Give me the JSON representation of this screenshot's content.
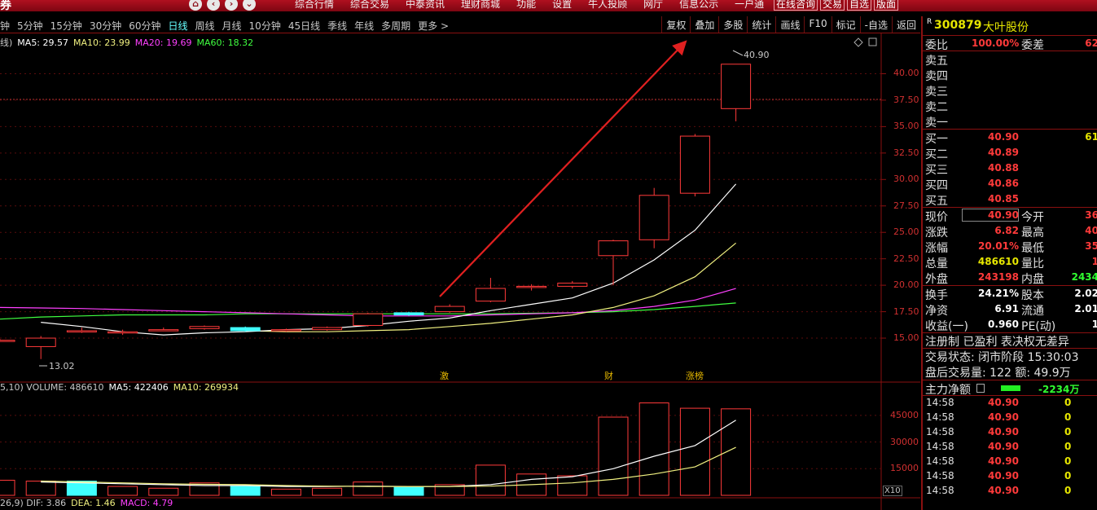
{
  "topbar": {
    "brand": "券",
    "menu": [
      "综合行情",
      "综合交易",
      "中泰资讯",
      "理财商城",
      "功能",
      "设置",
      "牛人投顾",
      "网厅",
      "信息公示",
      "一户通"
    ],
    "right_buttons": [
      "在线咨询",
      "交易",
      "自选",
      "版面"
    ]
  },
  "periods": {
    "items": [
      "钟",
      "5分钟",
      "15分钟",
      "30分钟",
      "60分钟",
      "日线",
      "周线",
      "月线",
      "10分钟",
      "45日线",
      "季线",
      "年线",
      "多周期",
      "更多 >"
    ],
    "active": "日线"
  },
  "tools": [
    "复权",
    "叠加",
    "多股",
    "统计",
    "画线",
    "F10",
    "标记",
    "-自选",
    "返回"
  ],
  "ma_legend": [
    {
      "text": "线)",
      "color": "#c8c8c8"
    },
    {
      "text": "MA5: 29.57",
      "color": "#ffffff"
    },
    {
      "text": "MA10: 23.99",
      "color": "#f0f080"
    },
    {
      "text": "MA20: 19.69",
      "color": "#ff40ff"
    },
    {
      "text": "MA60: 18.32",
      "color": "#40ff40"
    }
  ],
  "vol_legend": [
    {
      "text": "5,10) VOLUME: 486610",
      "color": "#c8c8c8"
    },
    {
      "text": "MA5: 422406",
      "color": "#ffffff"
    },
    {
      "text": "MA10: 269934",
      "color": "#f0f080"
    }
  ],
  "macd_legend": [
    {
      "text": "26,9) DIF: 3.86",
      "color": "#c8c8c8"
    },
    {
      "text": "DEA: 1.46",
      "color": "#f0f080"
    },
    {
      "text": "MACD: 4.79",
      "color": "#ff40ff"
    }
  ],
  "price_ticks": [
    "40.00",
    "37.50",
    "35.00",
    "32.50",
    "30.00",
    "27.50",
    "25.00",
    "22.50",
    "20.00",
    "17.50",
    "15.00"
  ],
  "volume_ticks": [
    "45000",
    "30000",
    "15000"
  ],
  "x10_label": "X10",
  "events": [
    "激",
    "财",
    "涨榜"
  ],
  "high_label": "40.90",
  "low_label": "13.02",
  "colors": {
    "up": "#ff3a3a",
    "down": "#40ffff",
    "accent": "#8a1010",
    "arrow": "#e02020"
  },
  "chart_data": {
    "type": "candlestick",
    "ylim": [
      13,
      41.5
    ],
    "candles": [
      {
        "o": 14.8,
        "c": 14.8,
        "h": 14.9,
        "l": 14.7
      },
      {
        "o": 14.2,
        "c": 15.0,
        "h": 15.2,
        "l": 13.02
      },
      {
        "o": 15.7,
        "c": 15.7,
        "h": 16.0,
        "l": 15.5
      },
      {
        "o": 15.5,
        "c": 15.6,
        "h": 15.8,
        "l": 15.3
      },
      {
        "o": 15.8,
        "c": 15.8,
        "h": 16.0,
        "l": 15.7
      },
      {
        "o": 15.9,
        "c": 16.1,
        "h": 16.2,
        "l": 15.8
      },
      {
        "o": 16.0,
        "c": 15.7,
        "h": 16.1,
        "l": 15.6
      },
      {
        "o": 15.7,
        "c": 15.8,
        "h": 15.9,
        "l": 15.6
      },
      {
        "o": 15.8,
        "c": 16.0,
        "h": 16.1,
        "l": 15.7
      },
      {
        "o": 16.2,
        "c": 17.3,
        "h": 17.4,
        "l": 16.1
      },
      {
        "o": 17.4,
        "c": 17.2,
        "h": 17.5,
        "l": 17.1
      },
      {
        "o": 17.5,
        "c": 18.0,
        "h": 18.2,
        "l": 17.4
      },
      {
        "o": 18.5,
        "c": 19.7,
        "h": 20.7,
        "l": 18.4
      },
      {
        "o": 19.8,
        "c": 19.9,
        "h": 20.1,
        "l": 19.5
      },
      {
        "o": 19.9,
        "c": 20.2,
        "h": 20.4,
        "l": 19.7
      },
      {
        "o": 22.8,
        "c": 24.2,
        "h": 24.3,
        "l": 20.0
      },
      {
        "o": 24.3,
        "c": 28.5,
        "h": 29.2,
        "l": 23.5
      },
      {
        "o": 28.7,
        "c": 34.1,
        "h": 34.3,
        "l": 28.4
      },
      {
        "o": 36.7,
        "c": 40.9,
        "h": 40.9,
        "l": 35.5
      }
    ],
    "ma5": [
      null,
      16.5,
      16.1,
      15.6,
      15.3,
      15.5,
      15.6,
      15.8,
      15.9,
      16.2,
      16.6,
      16.9,
      17.6,
      18.2,
      18.8,
      20.2,
      22.4,
      25.2,
      29.57
    ],
    "ma10": [
      null,
      null,
      null,
      null,
      null,
      null,
      15.7,
      15.6,
      15.6,
      15.7,
      15.8,
      16.1,
      16.4,
      16.8,
      17.2,
      17.9,
      19.0,
      20.8,
      23.99
    ],
    "ma20": [
      17.9,
      17.85,
      17.8,
      17.7,
      17.6,
      17.5,
      17.4,
      17.3,
      17.2,
      17.1,
      17.1,
      17.1,
      17.2,
      17.3,
      17.4,
      17.6,
      18.0,
      18.6,
      19.69
    ],
    "ma60": [
      16.8,
      17.0,
      17.1,
      17.2,
      17.2,
      17.2,
      17.3,
      17.3,
      17.3,
      17.3,
      17.3,
      17.3,
      17.3,
      17.35,
      17.4,
      17.5,
      17.7,
      18.0,
      18.32
    ],
    "volume_ylim": [
      0,
      55000
    ],
    "volume": [
      8500,
      8000,
      8000,
      5000,
      4000,
      7000,
      5000,
      3500,
      4000,
      7500,
      4500,
      6000,
      17000,
      12000,
      11000,
      44000,
      52000,
      49000,
      48661
    ],
    "vol_up": [
      true,
      true,
      false,
      true,
      true,
      true,
      false,
      true,
      true,
      true,
      false,
      true,
      true,
      true,
      true,
      true,
      true,
      true,
      true
    ],
    "vol_ma5": [
      null,
      7500,
      7000,
      6500,
      6000,
      5500,
      5500,
      5000,
      5000,
      5200,
      5000,
      5000,
      6000,
      9000,
      10500,
      15000,
      22000,
      28000,
      42240
    ],
    "vol_ma10": [
      null,
      8000,
      7500,
      7000,
      6500,
      6200,
      6000,
      5500,
      5200,
      5000,
      5000,
      5000,
      5200,
      6000,
      7000,
      9000,
      12000,
      16000,
      26993
    ]
  },
  "side": {
    "badge": "R",
    "code": "300879",
    "name": "大叶股份",
    "weibi": {
      "label": "委比",
      "value": "100.00%",
      "label2": "委差",
      "value2": "62"
    },
    "sells": [
      "卖五",
      "卖四",
      "卖三",
      "卖二",
      "卖一"
    ],
    "buys": [
      {
        "label": "买一",
        "price": "40.90",
        "vol": "61"
      },
      {
        "label": "买二",
        "price": "40.89",
        "vol": ""
      },
      {
        "label": "买三",
        "price": "40.88",
        "vol": ""
      },
      {
        "label": "买四",
        "price": "40.86",
        "vol": ""
      },
      {
        "label": "买五",
        "price": "40.85",
        "vol": ""
      }
    ],
    "quote": [
      {
        "l1": "现价",
        "v1": "40.90",
        "c1": "red",
        "l2": "今开",
        "v2": "36",
        "c2": "red"
      },
      {
        "l1": "涨跌",
        "v1": "6.82",
        "c1": "red",
        "l2": "最高",
        "v2": "40",
        "c2": "red"
      },
      {
        "l1": "涨幅",
        "v1": "20.01%",
        "c1": "red",
        "l2": "最低",
        "v2": "35",
        "c2": "red"
      },
      {
        "l1": "总量",
        "v1": "486610",
        "c1": "yellow",
        "l2": "量比",
        "v2": "1",
        "c2": "red"
      },
      {
        "l1": "外盘",
        "v1": "243198",
        "c1": "red",
        "l2": "内盘",
        "v2": "2434",
        "c2": "green"
      }
    ],
    "fund": [
      {
        "l1": "换手",
        "v1": "24.21%",
        "c1": "white",
        "l2": "股本",
        "v2": "2.02",
        "c2": "white"
      },
      {
        "l1": "净资",
        "v1": "6.91",
        "c1": "white",
        "l2": "流通",
        "v2": "2.01",
        "c2": "white"
      },
      {
        "l1": "收益(一)",
        "v1": "0.960",
        "c1": "white",
        "l2": "PE(动)",
        "v2": "1",
        "c2": "white"
      }
    ],
    "reg_line": "注册制 已盈利 表决权无差异",
    "trade_status": "交易状态: 闭市阶段 15:30:03",
    "after_hours": "盘后交易量: 122  额: 49.9万",
    "zhuli": {
      "label": "主力净额",
      "value": "-2234万"
    },
    "ticks": [
      {
        "time": "14:58",
        "price": "40.90",
        "vol": "0"
      },
      {
        "time": "14:58",
        "price": "40.90",
        "vol": "0"
      },
      {
        "time": "14:58",
        "price": "40.90",
        "vol": "0"
      },
      {
        "time": "14:58",
        "price": "40.90",
        "vol": "0"
      },
      {
        "time": "14:58",
        "price": "40.90",
        "vol": "0"
      },
      {
        "time": "14:58",
        "price": "40.90",
        "vol": "0"
      },
      {
        "time": "14:58",
        "price": "40.90",
        "vol": "0"
      }
    ]
  }
}
